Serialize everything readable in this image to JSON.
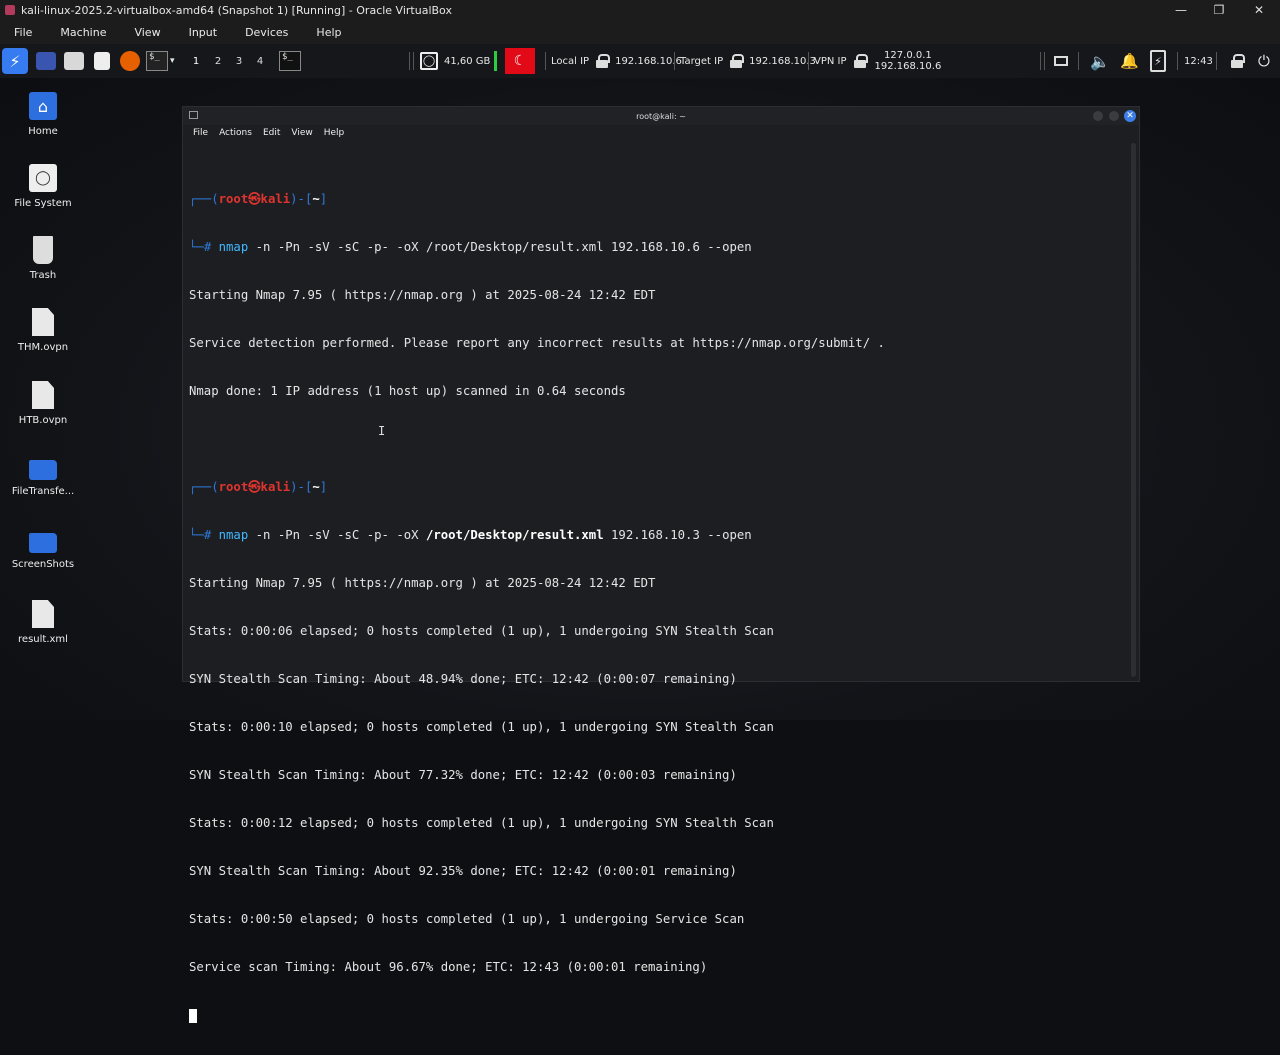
{
  "window": {
    "title": "kali-linux-2025.2-virtualbox-amd64 (Snapshot 1) [Running] - Oracle VirtualBox",
    "minimize": "—",
    "restore": "❐",
    "close": "✕"
  },
  "menubar": [
    "File",
    "Machine",
    "View",
    "Input",
    "Devices",
    "Help"
  ],
  "panel": {
    "workspaces": [
      "1",
      "2",
      "3",
      "4"
    ],
    "terminal_icon_text": "$_",
    "disk_usage": "41,60 GB",
    "local_ip_label": "Local IP",
    "local_ip": "192.168.10.6",
    "target_ip_label": "Target IP",
    "target_ip": "192.168.10.3",
    "vpn_ip_label": "VPN IP",
    "vpn_ip_1": "127.0.0.1",
    "vpn_ip_2": "192.168.10.6",
    "clock": "12:43"
  },
  "desktop_icons": [
    {
      "label": "Home"
    },
    {
      "label": "File System"
    },
    {
      "label": "Trash"
    },
    {
      "label": "THM.ovpn"
    },
    {
      "label": "HTB.ovpn"
    },
    {
      "label": "FileTransfe..."
    },
    {
      "label": "ScreenShots"
    },
    {
      "label": "result.xml"
    }
  ],
  "terminal": {
    "title": "root@kali: ~",
    "menu": [
      "File",
      "Actions",
      "Edit",
      "View",
      "Help"
    ],
    "prompt": {
      "open": "┌──(",
      "user": "root㉿kali",
      "mid": ")-[",
      "cwd": "~",
      "close": "]",
      "second": "└─",
      "hash": "# "
    },
    "commands": [
      {
        "name": "nmap",
        "args": " -n -Pn -sV -sC -p- -oX ",
        "path": "/root/Desktop/result.xml",
        "rest": " 192.168.10.6 --open"
      },
      {
        "name": "nmap",
        "args": " -n -Pn -sV -sC -p- -oX ",
        "path": "/root/Desktop/result.xml",
        "rest": " 192.168.10.3 --open"
      }
    ],
    "output_1": [
      "Starting Nmap 7.95 ( https://nmap.org ) at 2025-08-24 12:42 EDT",
      "Service detection performed. Please report any incorrect results at https://nmap.org/submit/ .",
      "Nmap done: 1 IP address (1 host up) scanned in 0.64 seconds"
    ],
    "output_2": [
      "Starting Nmap 7.95 ( https://nmap.org ) at 2025-08-24 12:42 EDT",
      "Stats: 0:00:06 elapsed; 0 hosts completed (1 up), 1 undergoing SYN Stealth Scan",
      "SYN Stealth Scan Timing: About 48.94% done; ETC: 12:42 (0:00:07 remaining)",
      "Stats: 0:00:10 elapsed; 0 hosts completed (1 up), 1 undergoing SYN Stealth Scan",
      "SYN Stealth Scan Timing: About 77.32% done; ETC: 12:42 (0:00:03 remaining)",
      "Stats: 0:00:12 elapsed; 0 hosts completed (1 up), 1 undergoing SYN Stealth Scan",
      "SYN Stealth Scan Timing: About 92.35% done; ETC: 12:42 (0:00:01 remaining)",
      "Stats: 0:00:50 elapsed; 0 hosts completed (1 up), 1 undergoing Service Scan",
      "Service scan Timing: About 96.67% done; ETC: 12:43 (0:00:01 remaining)"
    ]
  },
  "colors": {
    "accent": "#367bf0",
    "prompt_user": "#e0342f",
    "prompt_box": "#2f7ad8",
    "command": "#3fb8ff",
    "flag_red": "#e30a17"
  }
}
